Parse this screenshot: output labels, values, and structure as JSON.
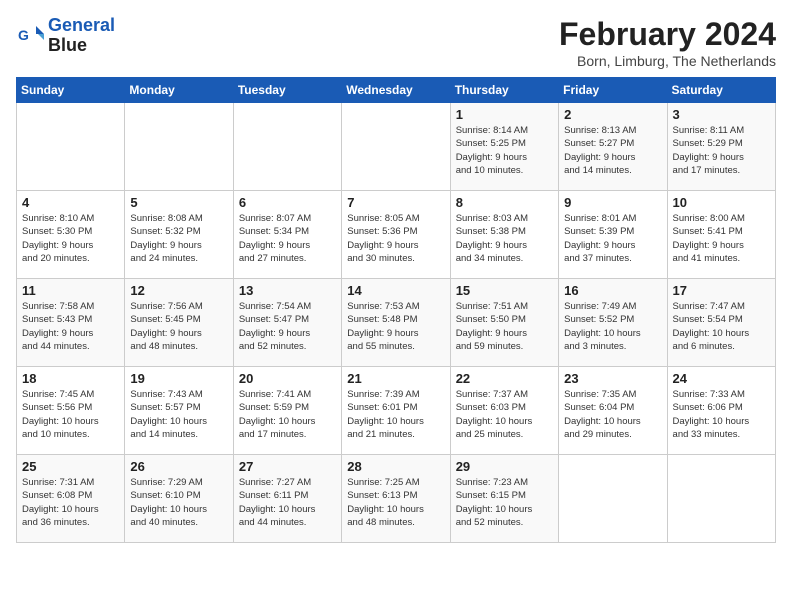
{
  "logo": {
    "line1": "General",
    "line2": "Blue"
  },
  "title": "February 2024",
  "location": "Born, Limburg, The Netherlands",
  "weekdays": [
    "Sunday",
    "Monday",
    "Tuesday",
    "Wednesday",
    "Thursday",
    "Friday",
    "Saturday"
  ],
  "weeks": [
    [
      {
        "day": "",
        "info": ""
      },
      {
        "day": "",
        "info": ""
      },
      {
        "day": "",
        "info": ""
      },
      {
        "day": "",
        "info": ""
      },
      {
        "day": "1",
        "info": "Sunrise: 8:14 AM\nSunset: 5:25 PM\nDaylight: 9 hours\nand 10 minutes."
      },
      {
        "day": "2",
        "info": "Sunrise: 8:13 AM\nSunset: 5:27 PM\nDaylight: 9 hours\nand 14 minutes."
      },
      {
        "day": "3",
        "info": "Sunrise: 8:11 AM\nSunset: 5:29 PM\nDaylight: 9 hours\nand 17 minutes."
      }
    ],
    [
      {
        "day": "4",
        "info": "Sunrise: 8:10 AM\nSunset: 5:30 PM\nDaylight: 9 hours\nand 20 minutes."
      },
      {
        "day": "5",
        "info": "Sunrise: 8:08 AM\nSunset: 5:32 PM\nDaylight: 9 hours\nand 24 minutes."
      },
      {
        "day": "6",
        "info": "Sunrise: 8:07 AM\nSunset: 5:34 PM\nDaylight: 9 hours\nand 27 minutes."
      },
      {
        "day": "7",
        "info": "Sunrise: 8:05 AM\nSunset: 5:36 PM\nDaylight: 9 hours\nand 30 minutes."
      },
      {
        "day": "8",
        "info": "Sunrise: 8:03 AM\nSunset: 5:38 PM\nDaylight: 9 hours\nand 34 minutes."
      },
      {
        "day": "9",
        "info": "Sunrise: 8:01 AM\nSunset: 5:39 PM\nDaylight: 9 hours\nand 37 minutes."
      },
      {
        "day": "10",
        "info": "Sunrise: 8:00 AM\nSunset: 5:41 PM\nDaylight: 9 hours\nand 41 minutes."
      }
    ],
    [
      {
        "day": "11",
        "info": "Sunrise: 7:58 AM\nSunset: 5:43 PM\nDaylight: 9 hours\nand 44 minutes."
      },
      {
        "day": "12",
        "info": "Sunrise: 7:56 AM\nSunset: 5:45 PM\nDaylight: 9 hours\nand 48 minutes."
      },
      {
        "day": "13",
        "info": "Sunrise: 7:54 AM\nSunset: 5:47 PM\nDaylight: 9 hours\nand 52 minutes."
      },
      {
        "day": "14",
        "info": "Sunrise: 7:53 AM\nSunset: 5:48 PM\nDaylight: 9 hours\nand 55 minutes."
      },
      {
        "day": "15",
        "info": "Sunrise: 7:51 AM\nSunset: 5:50 PM\nDaylight: 9 hours\nand 59 minutes."
      },
      {
        "day": "16",
        "info": "Sunrise: 7:49 AM\nSunset: 5:52 PM\nDaylight: 10 hours\nand 3 minutes."
      },
      {
        "day": "17",
        "info": "Sunrise: 7:47 AM\nSunset: 5:54 PM\nDaylight: 10 hours\nand 6 minutes."
      }
    ],
    [
      {
        "day": "18",
        "info": "Sunrise: 7:45 AM\nSunset: 5:56 PM\nDaylight: 10 hours\nand 10 minutes."
      },
      {
        "day": "19",
        "info": "Sunrise: 7:43 AM\nSunset: 5:57 PM\nDaylight: 10 hours\nand 14 minutes."
      },
      {
        "day": "20",
        "info": "Sunrise: 7:41 AM\nSunset: 5:59 PM\nDaylight: 10 hours\nand 17 minutes."
      },
      {
        "day": "21",
        "info": "Sunrise: 7:39 AM\nSunset: 6:01 PM\nDaylight: 10 hours\nand 21 minutes."
      },
      {
        "day": "22",
        "info": "Sunrise: 7:37 AM\nSunset: 6:03 PM\nDaylight: 10 hours\nand 25 minutes."
      },
      {
        "day": "23",
        "info": "Sunrise: 7:35 AM\nSunset: 6:04 PM\nDaylight: 10 hours\nand 29 minutes."
      },
      {
        "day": "24",
        "info": "Sunrise: 7:33 AM\nSunset: 6:06 PM\nDaylight: 10 hours\nand 33 minutes."
      }
    ],
    [
      {
        "day": "25",
        "info": "Sunrise: 7:31 AM\nSunset: 6:08 PM\nDaylight: 10 hours\nand 36 minutes."
      },
      {
        "day": "26",
        "info": "Sunrise: 7:29 AM\nSunset: 6:10 PM\nDaylight: 10 hours\nand 40 minutes."
      },
      {
        "day": "27",
        "info": "Sunrise: 7:27 AM\nSunset: 6:11 PM\nDaylight: 10 hours\nand 44 minutes."
      },
      {
        "day": "28",
        "info": "Sunrise: 7:25 AM\nSunset: 6:13 PM\nDaylight: 10 hours\nand 48 minutes."
      },
      {
        "day": "29",
        "info": "Sunrise: 7:23 AM\nSunset: 6:15 PM\nDaylight: 10 hours\nand 52 minutes."
      },
      {
        "day": "",
        "info": ""
      },
      {
        "day": "",
        "info": ""
      }
    ]
  ]
}
